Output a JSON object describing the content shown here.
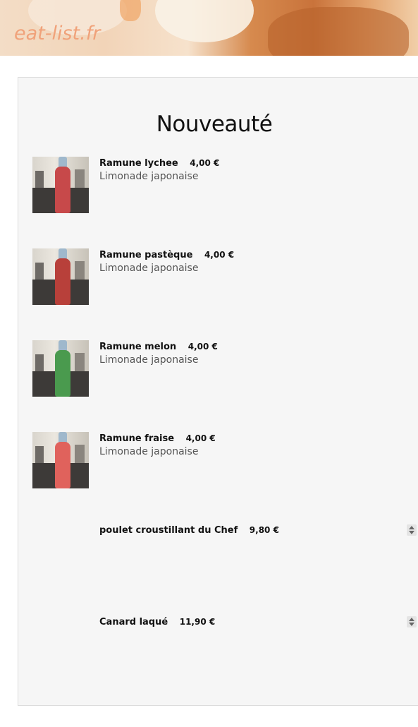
{
  "site": {
    "logo_text": "eat-list.fr"
  },
  "section": {
    "title": "Nouveauté"
  },
  "items": [
    {
      "name": "Ramune lychee",
      "price": "4,00 €",
      "description": "Limonade japonaise",
      "bottle_color": "#c7494a"
    },
    {
      "name": "Ramune pastèque",
      "price": "4,00 €",
      "description": "Limonade japonaise",
      "bottle_color": "#b8403a"
    },
    {
      "name": "Ramune melon",
      "price": "4,00 €",
      "description": "Limonade japonaise",
      "bottle_color": "#4a9a4e"
    },
    {
      "name": "Ramune fraise",
      "price": "4,00 €",
      "description": "Limonade japonaise",
      "bottle_color": "#e0625c"
    },
    {
      "name": "poulet croustillant du Chef",
      "price": "9,80 €"
    },
    {
      "name": "Canard laqué",
      "price": "11,90 €"
    }
  ]
}
